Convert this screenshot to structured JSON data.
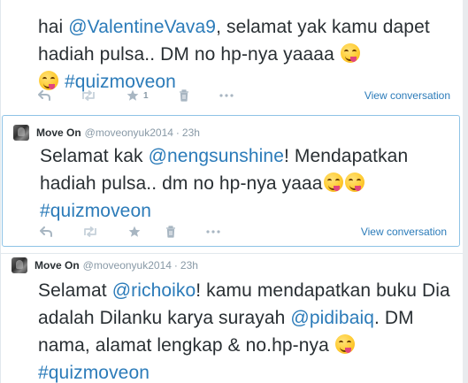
{
  "tweets": [
    {
      "segments": [
        {
          "text": "hai ",
          "link": false
        },
        {
          "text": "@ValentineVava9",
          "link": true
        },
        {
          "text": ", selamat yak kamu dapet hadiah pulsa.. DM no hp-nya yaaaa ",
          "link": false
        }
      ],
      "hashtag": "#quizmoveon",
      "favorite_count": "1",
      "view_conversation": "View conversation"
    },
    {
      "fullname": "Move On",
      "username": "@moveonyuk2014",
      "separator": "·",
      "time": "23h",
      "segments": [
        {
          "text": "Selamat kak ",
          "link": false
        },
        {
          "text": "@nengsunshine",
          "link": true
        },
        {
          "text": "! Mendapatkan hadiah pulsa.. dm no hp-nya yaaa",
          "link": false
        }
      ],
      "hashtag": "#quizmoveon",
      "view_conversation": "View conversation"
    },
    {
      "fullname": "Move On",
      "username": "@moveonyuk2014",
      "separator": "·",
      "time": "23h",
      "segments": [
        {
          "text": "Selamat ",
          "link": false
        },
        {
          "text": "@richoiko",
          "link": true
        },
        {
          "text": "! kamu mendapatkan buku Dia adalah Dilanku karya surayah ",
          "link": false
        },
        {
          "text": "@pidibaiq",
          "link": true
        },
        {
          "text": ". DM nama, alamat lengkap & no.hp-nya ",
          "link": false
        }
      ],
      "hashtag": "#quizmoveon"
    }
  ],
  "icons": {
    "reply": "reply-icon",
    "retweet": "retweet-icon",
    "favorite": "star-icon",
    "delete": "trash-icon",
    "emoji": "face-savoring-food-emoji"
  },
  "colors": {
    "link": "#2b7bb9",
    "text": "#292f33",
    "meta": "#8899a6",
    "action_icon": "#a8b6c2",
    "selected_border": "#8ec3e6",
    "divider": "#e1e8ed"
  }
}
